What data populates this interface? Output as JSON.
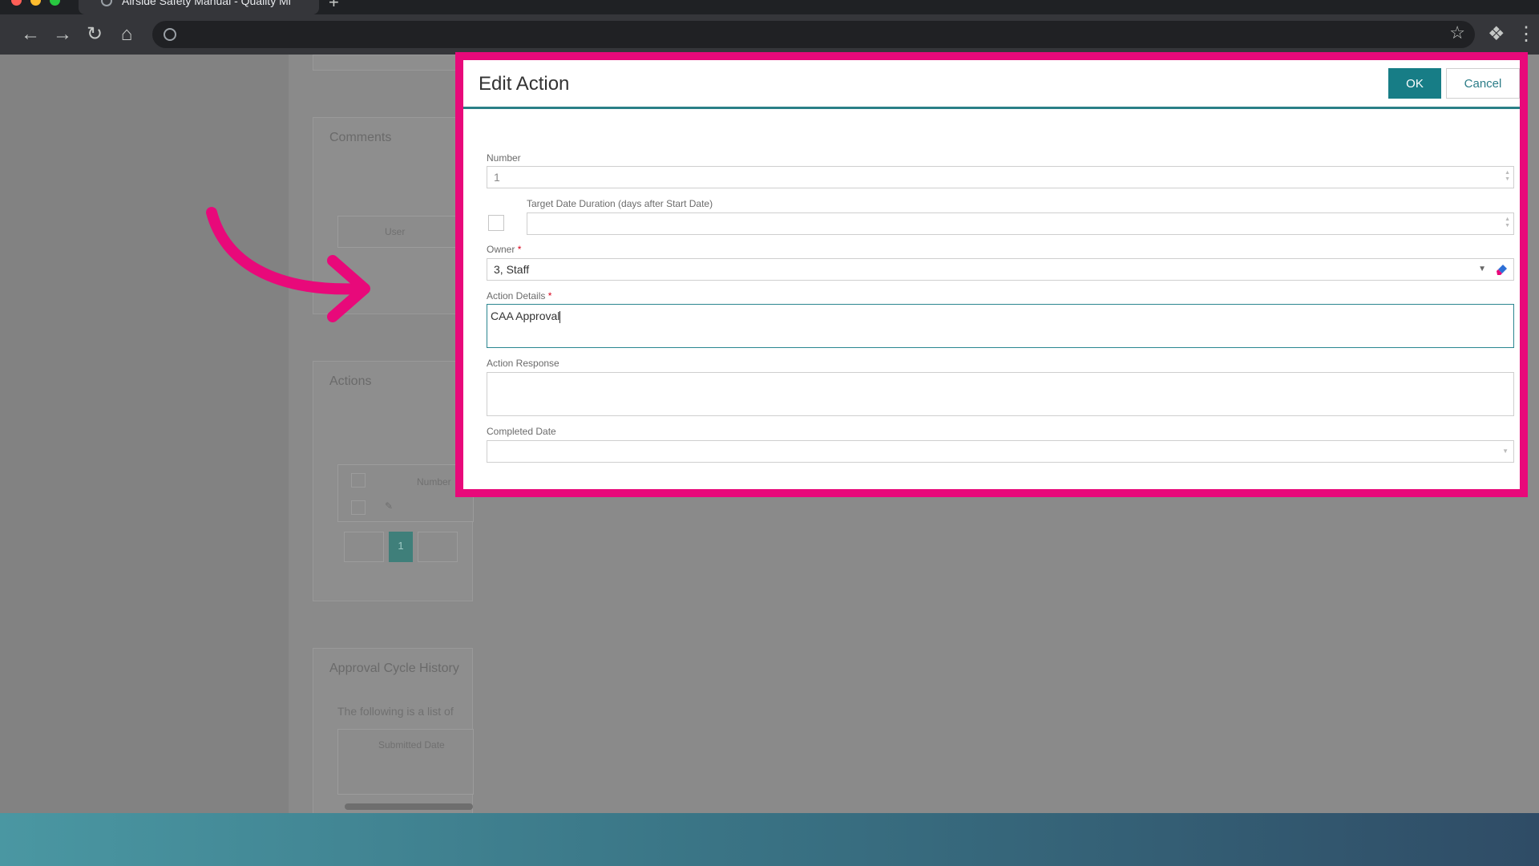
{
  "browser": {
    "tab_title": "Airside Safety Manual - Quality Mi",
    "colors": {
      "tabstrip": "#1f2124",
      "toolbar": "#35363a"
    }
  },
  "background_page": {
    "comments_title": "Comments",
    "comments_col_user": "User",
    "actions_title": "Actions",
    "actions_col_number": "Number",
    "pagination_current": "1",
    "approval_title": "Approval Cycle History",
    "approval_text": "The following is a list of",
    "approval_col_submitted": "Submitted Date"
  },
  "dialog": {
    "title": "Edit Action",
    "ok_label": "OK",
    "cancel_label": "Cancel",
    "highlight_color": "#e8097a",
    "accent_color": "#177d86",
    "fields": {
      "number": {
        "label": "Number",
        "value": "1"
      },
      "target_date_duration": {
        "label": "Target Date Duration (days after Start Date)",
        "value": "",
        "checked": false
      },
      "owner": {
        "label": "Owner",
        "required_mark": "*",
        "value": "3, Staff"
      },
      "action_details": {
        "label": "Action Details",
        "required_mark": "*",
        "value": "CAA Approval"
      },
      "action_response": {
        "label": "Action Response",
        "value": ""
      },
      "completed_date": {
        "label": "Completed Date",
        "value": ""
      }
    }
  },
  "icons": [
    "back-icon",
    "forward-icon",
    "reload-icon",
    "home-icon",
    "globe-icon",
    "star-icon",
    "extensions-icon",
    "menu-icon",
    "chevron-down-icon",
    "eraser-icon",
    "pencil-icon",
    "arrow-icon"
  ]
}
